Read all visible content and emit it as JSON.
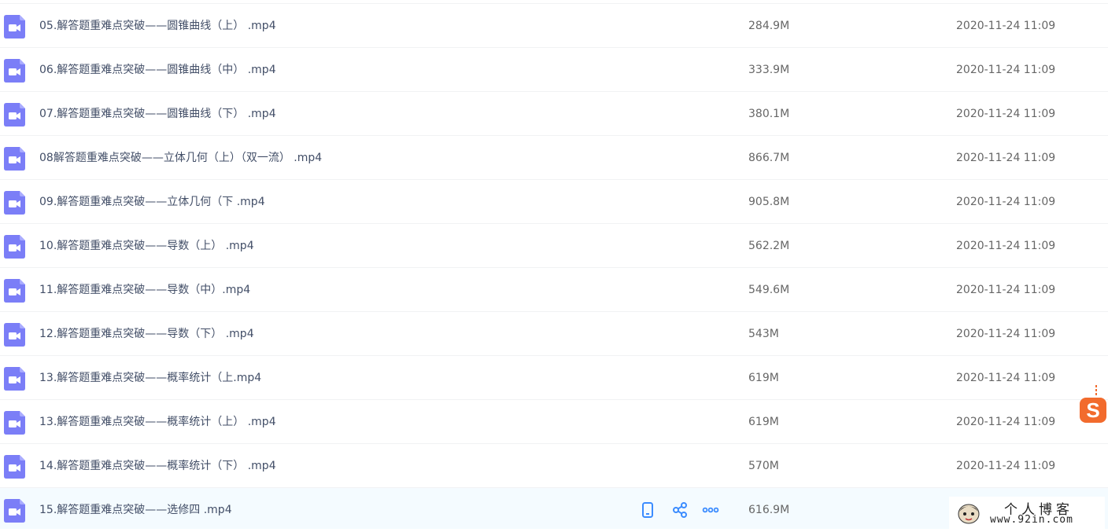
{
  "files": [
    {
      "name": "05.解答题重难点突破——圆锥曲线（上） .mp4",
      "size": "284.9M",
      "time": "2020-11-24 11:09"
    },
    {
      "name": "06.解答题重难点突破——圆锥曲线（中） .mp4",
      "size": "333.9M",
      "time": "2020-11-24 11:09"
    },
    {
      "name": "07.解答题重难点突破——圆锥曲线（下） .mp4",
      "size": "380.1M",
      "time": "2020-11-24 11:09"
    },
    {
      "name": "08解答题重难点突破——立体几何（上）（双一流） .mp4",
      "size": "866.7M",
      "time": "2020-11-24 11:09"
    },
    {
      "name": "09.解答题重难点突破——立体几何（下 .mp4",
      "size": "905.8M",
      "time": "2020-11-24 11:09"
    },
    {
      "name": "10.解答题重难点突破——导数（上） .mp4",
      "size": "562.2M",
      "time": "2020-11-24 11:09"
    },
    {
      "name": "11.解答题重难点突破——导数（中）.mp4",
      "size": "549.6M",
      "time": "2020-11-24 11:09"
    },
    {
      "name": "12.解答题重难点突破——导数（下） .mp4",
      "size": "543M",
      "time": "2020-11-24 11:09"
    },
    {
      "name": "13.解答题重难点突破——概率统计（上.mp4",
      "size": "619M",
      "time": "2020-11-24 11:09"
    },
    {
      "name": "13.解答题重难点突破——概率统计（上） .mp4",
      "size": "619M",
      "time": "2020-11-24 11:09"
    },
    {
      "name": "14.解答题重难点突破——概率统计（下） .mp4",
      "size": "570M",
      "time": "2020-11-24 11:09"
    },
    {
      "name": "15.解答题重难点突破——选修四 .mp4",
      "size": "616.9M",
      "time": ""
    }
  ],
  "icons": {
    "file": "video-file-icon",
    "phone": "phone-icon",
    "share": "share-icon",
    "more": "more-icon",
    "side_badge": "sogou-s-icon"
  },
  "colors": {
    "file_icon": "#7b7ef7",
    "action_icon": "#3b8cff",
    "hover_row": "#f4fbff",
    "badge": "#f26b2d"
  },
  "watermark": {
    "title": "个人博客",
    "url": "www.92in.com"
  }
}
